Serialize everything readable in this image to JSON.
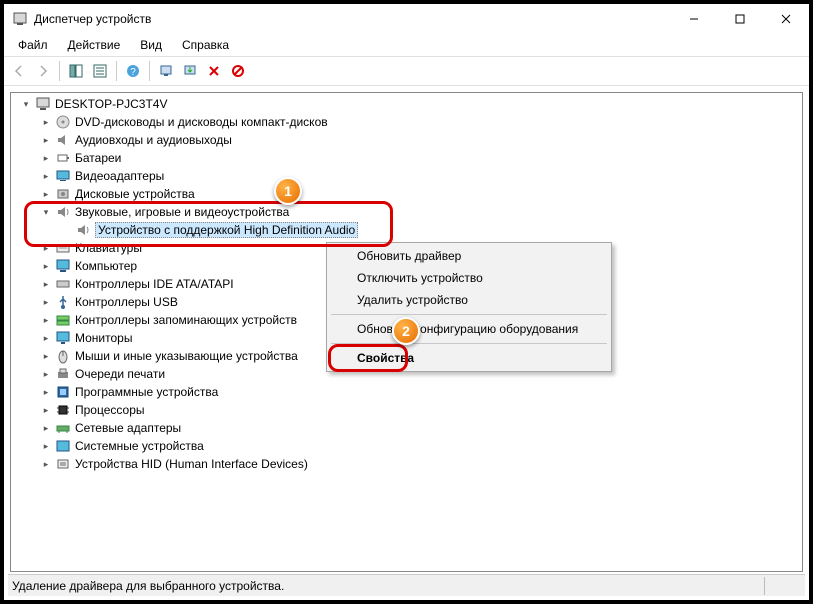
{
  "window": {
    "title": "Диспетчер устройств"
  },
  "menu": {
    "file": "Файл",
    "action": "Действие",
    "view": "Вид",
    "help": "Справка"
  },
  "tree": {
    "root": "DESKTOP-PJC3T4V",
    "items": [
      "DVD-дисководы и дисководы компакт-дисков",
      "Аудиовходы и аудиовыходы",
      "Батареи",
      "Видеоадаптеры",
      "Дисковые устройства",
      "Звуковые, игровые и видеоустройства",
      "Клавиатуры",
      "Компьютер",
      "Контроллеры IDE ATA/ATAPI",
      "Контроллеры USB",
      "Контроллеры запоминающих устройств",
      "Мониторы",
      "Мыши и иные указывающие устройства",
      "Очереди печати",
      "Программные устройства",
      "Процессоры",
      "Сетевые адаптеры",
      "Системные устройства",
      "Устройства HID (Human Interface Devices)"
    ],
    "selected_child": "Устройство с поддержкой High Definition Audio"
  },
  "context_menu": {
    "update": "Обновить драйвер",
    "disable": "Отключить устройство",
    "remove": "Удалить устройство",
    "refresh": "Обновить конфигурацию оборудования",
    "properties": "Свойства"
  },
  "callouts": {
    "one": "1",
    "two": "2"
  },
  "status": "Удаление драйвера для выбранного устройства."
}
